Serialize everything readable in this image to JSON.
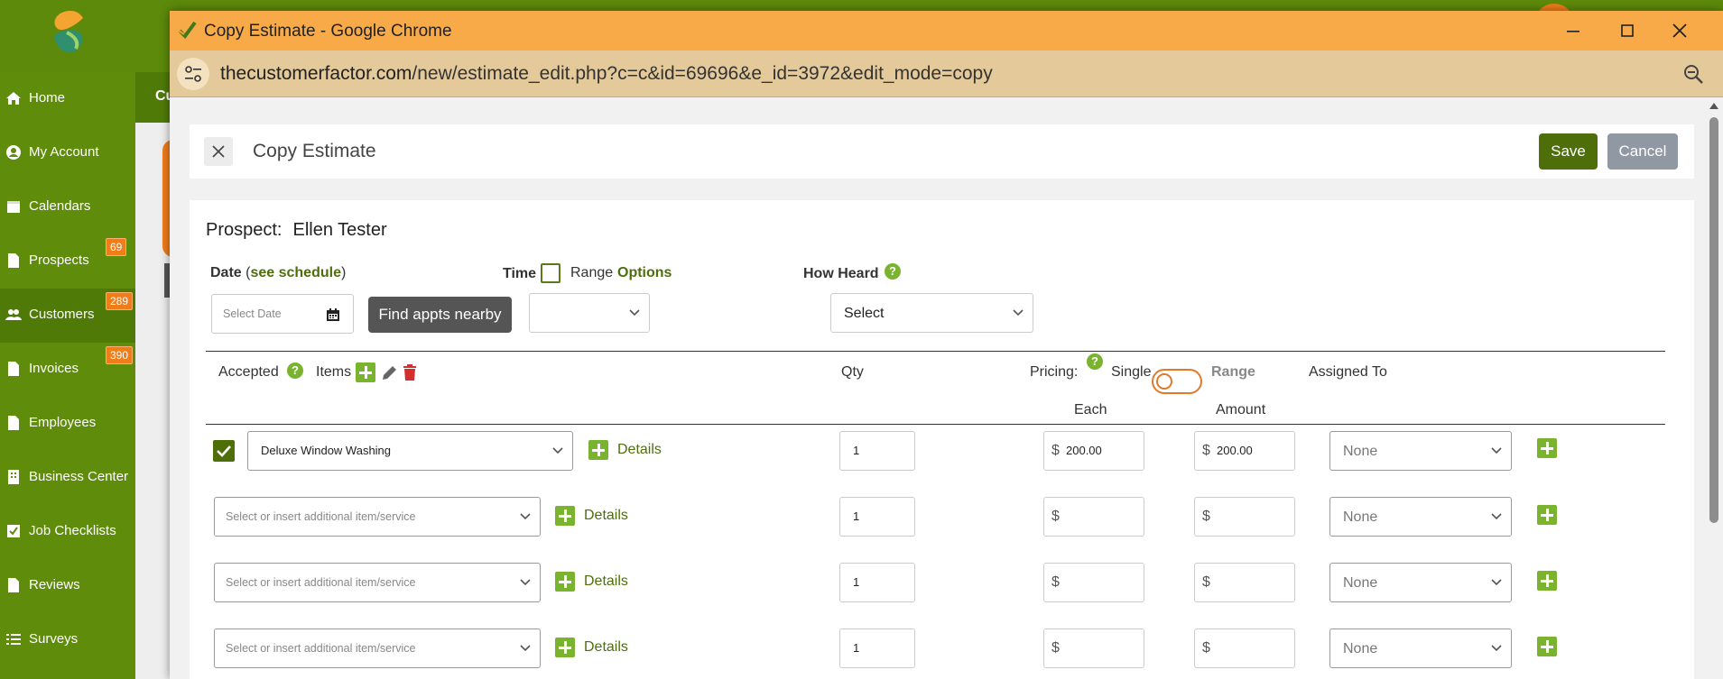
{
  "app": {
    "sidebar_items": [
      {
        "label": "Home",
        "icon": "home-icon"
      },
      {
        "label": "My Account",
        "icon": "user-icon"
      },
      {
        "label": "Calendars",
        "icon": "calendar-icon"
      },
      {
        "label": "Prospects",
        "icon": "document-icon",
        "badge": "69"
      },
      {
        "label": "Customers",
        "icon": "users-icon",
        "badge": "289"
      },
      {
        "label": "Invoices",
        "icon": "document-icon",
        "badge": "390"
      },
      {
        "label": "Employees",
        "icon": "document-icon"
      },
      {
        "label": "Business Center",
        "icon": "building-icon"
      },
      {
        "label": "Job Checklists",
        "icon": "checkbox-icon"
      },
      {
        "label": "Reviews",
        "icon": "document-icon"
      },
      {
        "label": "Surveys",
        "icon": "list-icon"
      }
    ],
    "bg_tab_label": "Cu",
    "brand_color": "#5d8a0a",
    "badge_color": "#f07c1a"
  },
  "window": {
    "title": "Copy Estimate - Google Chrome",
    "url_domain": "thecustomerfactor.com",
    "url_path": "/new/estimate_edit.php?c=c&id=69696&e_id=3972&edit_mode=copy",
    "titlebar_color": "#f8aa49"
  },
  "modal": {
    "title": "Copy Estimate",
    "save_label": "Save",
    "cancel_label": "Cancel"
  },
  "form": {
    "prospect_label": "Prospect:",
    "prospect_name": "Ellen Tester",
    "date_label": "Date",
    "date_paren_open": "(",
    "see_schedule": "see schedule",
    "date_paren_close": ")",
    "date_placeholder": "Select Date",
    "find_appts": "Find appts nearby",
    "time_label": "Time",
    "range_label": "Range",
    "options_label": "Options",
    "how_heard_label": "How Heard",
    "how_heard_value": "Select",
    "accepted_label": "Accepted",
    "items_label": "Items",
    "qty_label": "Qty",
    "pricing_label": "Pricing:",
    "single_label": "Single",
    "range_toggle_label": "Range",
    "assigned_label": "Assigned To",
    "each_label": "Each",
    "amount_label": "Amount",
    "currency": "$",
    "details_label": "Details",
    "item_placeholder": "Select or insert additional item/service"
  },
  "line_items": [
    {
      "item": "Deluxe Window Washing",
      "qty": "1",
      "each": "200.00",
      "amount": "200.00",
      "assigned": "None",
      "accepted": true
    },
    {
      "item": "",
      "qty": "1",
      "each": "",
      "amount": "",
      "assigned": "None",
      "accepted": false
    },
    {
      "item": "",
      "qty": "1",
      "each": "",
      "amount": "",
      "assigned": "None",
      "accepted": false
    },
    {
      "item": "",
      "qty": "1",
      "each": "",
      "amount": "",
      "assigned": "None",
      "accepted": false
    }
  ]
}
